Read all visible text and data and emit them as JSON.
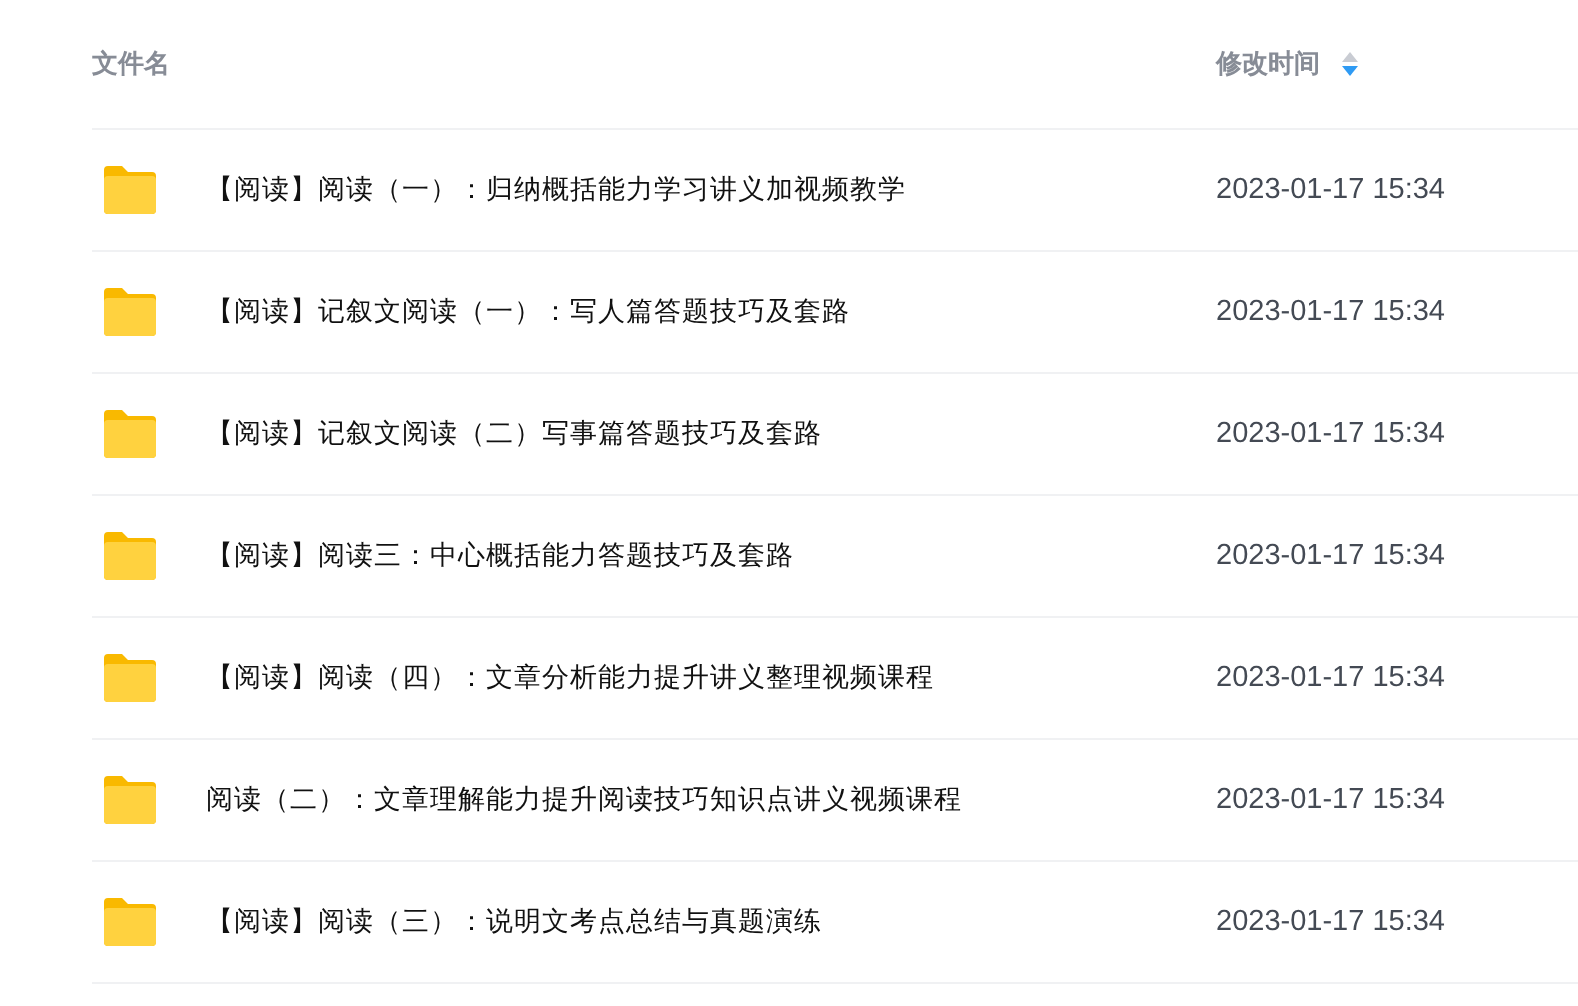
{
  "table": {
    "columns": [
      {
        "label": "文件名"
      },
      {
        "label": "修改时间",
        "sort_descending": true
      }
    ],
    "rows": [
      {
        "name": "【阅读】阅读（一）：归纳概括能力学习讲义加视频教学",
        "modified": "2023-01-17 15:34"
      },
      {
        "name": "【阅读】记叙文阅读（一）：写人篇答题技巧及套路",
        "modified": "2023-01-17 15:34"
      },
      {
        "name": "【阅读】记叙文阅读（二）写事篇答题技巧及套路",
        "modified": "2023-01-17 15:34"
      },
      {
        "name": "【阅读】阅读三：中心概括能力答题技巧及套路",
        "modified": "2023-01-17 15:34"
      },
      {
        "name": "【阅读】阅读（四）：文章分析能力提升讲义整理视频课程",
        "modified": "2023-01-17 15:34"
      },
      {
        "name": "阅读（二）：文章理解能力提升阅读技巧知识点讲义视频课程",
        "modified": "2023-01-17 15:34"
      },
      {
        "name": "【阅读】阅读（三）：说明文考点总结与真题演练",
        "modified": "2023-01-17 15:34"
      }
    ]
  }
}
